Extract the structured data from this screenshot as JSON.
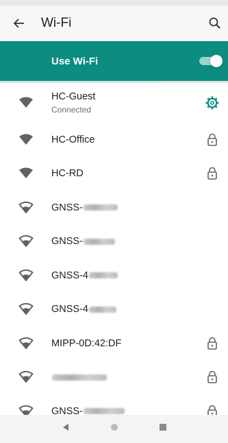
{
  "toolbar": {
    "title": "Wi-Fi",
    "back_icon": "back-arrow-icon",
    "search_icon": "search-icon"
  },
  "master": {
    "label": "Use Wi-Fi",
    "enabled": true
  },
  "colors": {
    "accent": "#0d8c80",
    "icon": "#5f6368"
  },
  "networks": [
    {
      "ssid": "HC-Guest",
      "summary": "Connected",
      "signal": "filled",
      "trailing": "gear-icon"
    },
    {
      "ssid": "HC-Office",
      "signal": "filled",
      "trailing": "lock-icon"
    },
    {
      "ssid": "HC-RD",
      "signal": "filled",
      "trailing": "lock-icon"
    },
    {
      "ssid": "GNSS-",
      "signal": "outline",
      "trailing": ""
    },
    {
      "ssid": "GNSS-",
      "signal": "outline",
      "trailing": ""
    },
    {
      "ssid": "GNSS-4",
      "signal": "outline",
      "trailing": ""
    },
    {
      "ssid": "GNSS-4",
      "signal": "outline",
      "trailing": ""
    },
    {
      "ssid": "MIPP-0D:42:DF",
      "signal": "outline",
      "trailing": "lock-icon"
    },
    {
      "ssid": "",
      "signal": "outline",
      "trailing": "lock-icon"
    },
    {
      "ssid": "GNSS-",
      "signal": "outline",
      "trailing": "lock-icon"
    }
  ],
  "navbar": {
    "back": "nav-back-icon",
    "home": "nav-home-icon",
    "recents": "nav-recents-icon"
  }
}
